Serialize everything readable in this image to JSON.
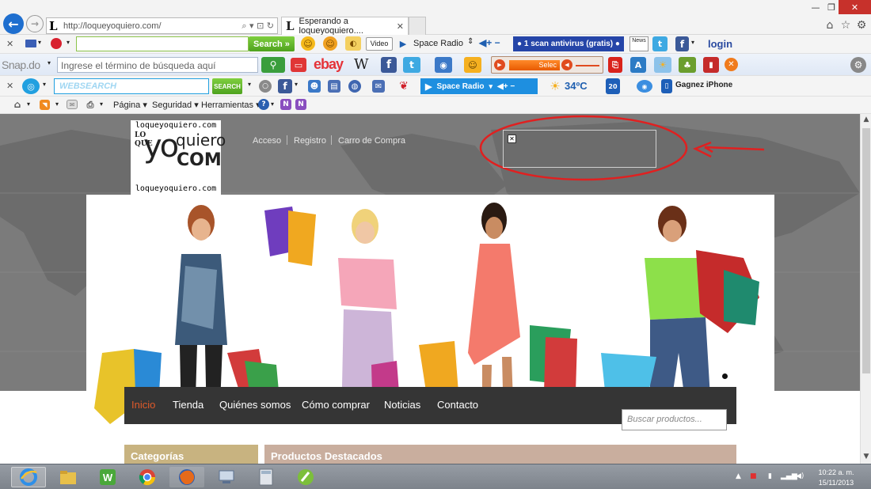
{
  "browser": {
    "address_url": "http://loqueyoquiero.com/",
    "tab_title": "Esperando a loqueyoquiero....",
    "tab_favicon": "L"
  },
  "toolbar1": {
    "search_button": "Search",
    "video_label": "Video",
    "space_radio": "Space Radio",
    "antivirus_label": "● 1 scan antivirus (gratis) ●",
    "news_label": "News",
    "login_label": "login"
  },
  "toolbar2": {
    "brand": "Snap.do",
    "search_placeholder": "Ingrese el término de búsqueda aquí",
    "ebay": "ebay",
    "wiki": "W",
    "player_label": "Selec"
  },
  "toolbar3": {
    "web_search": "WEBSEARCH",
    "search_btn": "SEARCH",
    "space_radio": "Space Radio",
    "temperature": "34ºC",
    "iphone_promo": "Gagnez iPhone",
    "badge_20": "20"
  },
  "toolbar4": {
    "pagina": "Página",
    "seguridad": "Seguridad",
    "herramientas": "Herramientas"
  },
  "site": {
    "logo": {
      "top_text": "loqueyoquiero.com",
      "bottom_text": "loqueyoquiero.com",
      "side_text": "LO QUE",
      "yo": "yo",
      "quiero": "quiero",
      "com": "COM"
    },
    "top_links": [
      "Acceso",
      "Registro",
      "Carro de Compra"
    ],
    "nav": [
      "Inicio",
      "Tienda",
      "Quiénes somos",
      "Cómo comprar",
      "Noticias",
      "Contacto"
    ],
    "search_placeholder": "Buscar productos...",
    "categories_title": "Categorías",
    "featured_title": "Productos Destacados"
  },
  "taskbar": {
    "time": "10:22 a. m.",
    "date": "15/11/2013"
  },
  "colors": {
    "ie_blue": "#1f6fcf",
    "nav_active": "#e05a2a",
    "annotation_red": "#e02020",
    "nav_bar": "#353535"
  }
}
